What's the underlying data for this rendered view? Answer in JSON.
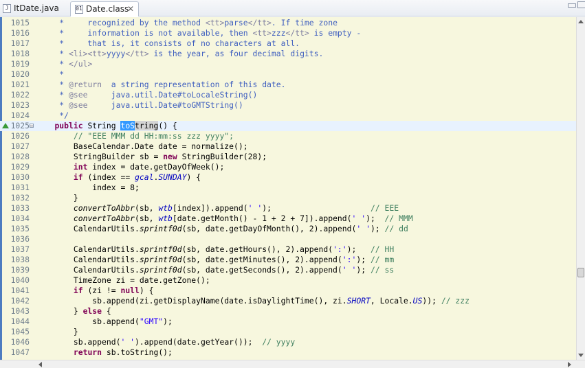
{
  "tabs": [
    {
      "label": "ItDate.java",
      "active": false
    },
    {
      "label": "Date.class",
      "active": true
    }
  ],
  "editor": {
    "current_line": "1025",
    "lines": [
      {
        "n": "1015",
        "t": [
          [
            "     *     recognized by the method ",
            "dc"
          ],
          [
            "<tt>",
            "tg"
          ],
          [
            "parse",
            "dc"
          ],
          [
            "</tt>",
            "tg"
          ],
          [
            ". If time zone",
            "dc"
          ]
        ]
      },
      {
        "n": "1016",
        "t": [
          [
            "     *     information is not available, then ",
            "dc"
          ],
          [
            "<tt>",
            "tg"
          ],
          [
            "zzz",
            "dc"
          ],
          [
            "</tt>",
            "tg"
          ],
          [
            " is empty -",
            "dc"
          ]
        ]
      },
      {
        "n": "1017",
        "t": [
          [
            "     *     that is, it consists of no characters at all.",
            "dc"
          ]
        ]
      },
      {
        "n": "1018",
        "t": [
          [
            "     * ",
            "dc"
          ],
          [
            "<li><tt>",
            "tg"
          ],
          [
            "yyyy",
            "dc"
          ],
          [
            "</tt>",
            "tg"
          ],
          [
            " is the year, as four decimal digits.",
            "dc"
          ]
        ]
      },
      {
        "n": "1019",
        "t": [
          [
            "     * ",
            "dc"
          ],
          [
            "</ul>",
            "tg"
          ]
        ]
      },
      {
        "n": "1020",
        "t": [
          [
            "     *",
            "dc"
          ]
        ]
      },
      {
        "n": "1021",
        "t": [
          [
            "     * ",
            "dc"
          ],
          [
            "@return",
            "tg"
          ],
          [
            "  a string representation of this date.",
            "dc"
          ]
        ]
      },
      {
        "n": "1022",
        "t": [
          [
            "     * ",
            "dc"
          ],
          [
            "@see",
            "tg"
          ],
          [
            "     java.util.Date#toLocaleString()",
            "dc"
          ]
        ]
      },
      {
        "n": "1023",
        "t": [
          [
            "     * ",
            "dc"
          ],
          [
            "@see",
            "tg"
          ],
          [
            "     java.util.Date#toGMTString()",
            "dc"
          ]
        ]
      },
      {
        "n": "1024",
        "t": [
          [
            "     */",
            "dc"
          ]
        ]
      },
      {
        "n": "1025",
        "t": [
          [
            "    ",
            ""
          ],
          [
            "public",
            "kw"
          ],
          [
            " String ",
            ""
          ],
          [
            "toS",
            "sel"
          ],
          [
            "tring",
            "occ"
          ],
          [
            "() {",
            ""
          ]
        ]
      },
      {
        "n": "1026",
        "t": [
          [
            "        // \"EEE MMM dd HH:mm:ss zzz yyyy\";",
            "cm"
          ]
        ]
      },
      {
        "n": "1027",
        "t": [
          [
            "        BaseCalendar.Date date = normalize();",
            ""
          ]
        ]
      },
      {
        "n": "1028",
        "t": [
          [
            "        StringBuilder sb = ",
            ""
          ],
          [
            "new",
            "kw"
          ],
          [
            " StringBuilder(28);",
            ""
          ]
        ]
      },
      {
        "n": "1029",
        "t": [
          [
            "        ",
            ""
          ],
          [
            "int",
            "kw"
          ],
          [
            " index = date.getDayOfWeek();",
            ""
          ]
        ]
      },
      {
        "n": "1030",
        "t": [
          [
            "        ",
            ""
          ],
          [
            "if",
            "kw"
          ],
          [
            " (index == ",
            ""
          ],
          [
            "gcal",
            "fi"
          ],
          [
            ".",
            ""
          ],
          [
            "SUNDAY",
            "fi"
          ],
          [
            ") {",
            ""
          ]
        ]
      },
      {
        "n": "1031",
        "t": [
          [
            "            index = 8;",
            ""
          ]
        ]
      },
      {
        "n": "1032",
        "t": [
          [
            "        }",
            ""
          ]
        ]
      },
      {
        "n": "1033",
        "t": [
          [
            "        ",
            ""
          ],
          [
            "convertToAbbr",
            "it"
          ],
          [
            "(sb, ",
            ""
          ],
          [
            "wtb",
            "fi"
          ],
          [
            "[index]).append(",
            ""
          ],
          [
            "' '",
            "st"
          ],
          [
            ");                     ",
            ""
          ],
          [
            "// EEE",
            "cm"
          ]
        ]
      },
      {
        "n": "1034",
        "t": [
          [
            "        ",
            ""
          ],
          [
            "convertToAbbr",
            "it"
          ],
          [
            "(sb, ",
            ""
          ],
          [
            "wtb",
            "fi"
          ],
          [
            "[date.getMonth() - 1 + 2 + 7]).append(",
            ""
          ],
          [
            "' '",
            "st"
          ],
          [
            ");  ",
            ""
          ],
          [
            "// MMM",
            "cm"
          ]
        ]
      },
      {
        "n": "1035",
        "t": [
          [
            "        CalendarUtils.",
            ""
          ],
          [
            "sprintf0d",
            "it"
          ],
          [
            "(sb, date.getDayOfMonth(), 2).append(",
            ""
          ],
          [
            "' '",
            "st"
          ],
          [
            "); ",
            ""
          ],
          [
            "// dd",
            "cm"
          ]
        ]
      },
      {
        "n": "1036",
        "t": [
          [
            "",
            ""
          ]
        ]
      },
      {
        "n": "1037",
        "t": [
          [
            "        CalendarUtils.",
            ""
          ],
          [
            "sprintf0d",
            "it"
          ],
          [
            "(sb, date.getHours(), 2).append(",
            ""
          ],
          [
            "':'",
            "st"
          ],
          [
            ");   ",
            ""
          ],
          [
            "// HH",
            "cm"
          ]
        ]
      },
      {
        "n": "1038",
        "t": [
          [
            "        CalendarUtils.",
            ""
          ],
          [
            "sprintf0d",
            "it"
          ],
          [
            "(sb, date.getMinutes(), 2).append(",
            ""
          ],
          [
            "':'",
            "st"
          ],
          [
            "); ",
            ""
          ],
          [
            "// mm",
            "cm"
          ]
        ]
      },
      {
        "n": "1039",
        "t": [
          [
            "        CalendarUtils.",
            ""
          ],
          [
            "sprintf0d",
            "it"
          ],
          [
            "(sb, date.getSeconds(), 2).append(",
            ""
          ],
          [
            "' '",
            "st"
          ],
          [
            "); ",
            ""
          ],
          [
            "// ss",
            "cm"
          ]
        ]
      },
      {
        "n": "1040",
        "t": [
          [
            "        TimeZone zi = date.getZone();",
            ""
          ]
        ]
      },
      {
        "n": "1041",
        "t": [
          [
            "        ",
            ""
          ],
          [
            "if",
            "kw"
          ],
          [
            " (zi != ",
            ""
          ],
          [
            "null",
            "kw"
          ],
          [
            ") {",
            ""
          ]
        ]
      },
      {
        "n": "1042",
        "t": [
          [
            "            sb.append(zi.getDisplayName(date.isDaylightTime(), zi.",
            ""
          ],
          [
            "SHORT",
            "fi"
          ],
          [
            ", Locale.",
            ""
          ],
          [
            "US",
            "fi"
          ],
          [
            ")); ",
            ""
          ],
          [
            "// zzz",
            "cm"
          ]
        ]
      },
      {
        "n": "1043",
        "t": [
          [
            "        } ",
            ""
          ],
          [
            "else",
            "kw"
          ],
          [
            " {",
            ""
          ]
        ]
      },
      {
        "n": "1044",
        "t": [
          [
            "            sb.append(",
            ""
          ],
          [
            "\"GMT\"",
            "st"
          ],
          [
            ");",
            ""
          ]
        ]
      },
      {
        "n": "1045",
        "t": [
          [
            "        }",
            ""
          ]
        ]
      },
      {
        "n": "1046",
        "t": [
          [
            "        sb.append(",
            ""
          ],
          [
            "' '",
            "st"
          ],
          [
            ").append(date.getYear());  ",
            ""
          ],
          [
            "// yyyy",
            "cm"
          ]
        ]
      },
      {
        "n": "1047",
        "t": [
          [
            "        ",
            ""
          ],
          [
            "return",
            "kw"
          ],
          [
            " sb.toString();",
            ""
          ]
        ]
      }
    ]
  }
}
